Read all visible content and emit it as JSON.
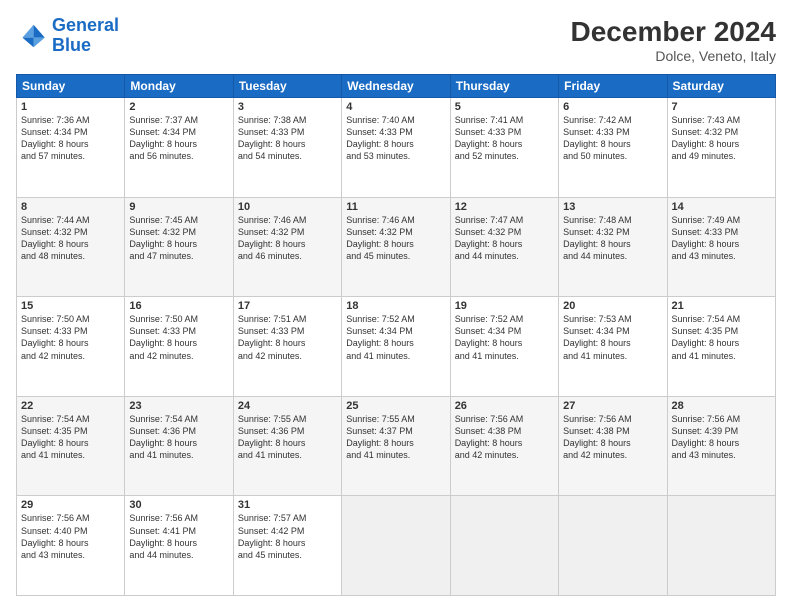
{
  "header": {
    "logo_line1": "General",
    "logo_line2": "Blue",
    "month": "December 2024",
    "location": "Dolce, Veneto, Italy"
  },
  "weekdays": [
    "Sunday",
    "Monday",
    "Tuesday",
    "Wednesday",
    "Thursday",
    "Friday",
    "Saturday"
  ],
  "weeks": [
    [
      {
        "day": "1",
        "sunrise": "7:36 AM",
        "sunset": "4:34 PM",
        "daylight": "8 hours and 57 minutes."
      },
      {
        "day": "2",
        "sunrise": "7:37 AM",
        "sunset": "4:34 PM",
        "daylight": "8 hours and 56 minutes."
      },
      {
        "day": "3",
        "sunrise": "7:38 AM",
        "sunset": "4:33 PM",
        "daylight": "8 hours and 54 minutes."
      },
      {
        "day": "4",
        "sunrise": "7:40 AM",
        "sunset": "4:33 PM",
        "daylight": "8 hours and 53 minutes."
      },
      {
        "day": "5",
        "sunrise": "7:41 AM",
        "sunset": "4:33 PM",
        "daylight": "8 hours and 52 minutes."
      },
      {
        "day": "6",
        "sunrise": "7:42 AM",
        "sunset": "4:33 PM",
        "daylight": "8 hours and 50 minutes."
      },
      {
        "day": "7",
        "sunrise": "7:43 AM",
        "sunset": "4:32 PM",
        "daylight": "8 hours and 49 minutes."
      }
    ],
    [
      {
        "day": "8",
        "sunrise": "7:44 AM",
        "sunset": "4:32 PM",
        "daylight": "8 hours and 48 minutes."
      },
      {
        "day": "9",
        "sunrise": "7:45 AM",
        "sunset": "4:32 PM",
        "daylight": "8 hours and 47 minutes."
      },
      {
        "day": "10",
        "sunrise": "7:46 AM",
        "sunset": "4:32 PM",
        "daylight": "8 hours and 46 minutes."
      },
      {
        "day": "11",
        "sunrise": "7:46 AM",
        "sunset": "4:32 PM",
        "daylight": "8 hours and 45 minutes."
      },
      {
        "day": "12",
        "sunrise": "7:47 AM",
        "sunset": "4:32 PM",
        "daylight": "8 hours and 44 minutes."
      },
      {
        "day": "13",
        "sunrise": "7:48 AM",
        "sunset": "4:32 PM",
        "daylight": "8 hours and 44 minutes."
      },
      {
        "day": "14",
        "sunrise": "7:49 AM",
        "sunset": "4:33 PM",
        "daylight": "8 hours and 43 minutes."
      }
    ],
    [
      {
        "day": "15",
        "sunrise": "7:50 AM",
        "sunset": "4:33 PM",
        "daylight": "8 hours and 42 minutes."
      },
      {
        "day": "16",
        "sunrise": "7:50 AM",
        "sunset": "4:33 PM",
        "daylight": "8 hours and 42 minutes."
      },
      {
        "day": "17",
        "sunrise": "7:51 AM",
        "sunset": "4:33 PM",
        "daylight": "8 hours and 42 minutes."
      },
      {
        "day": "18",
        "sunrise": "7:52 AM",
        "sunset": "4:34 PM",
        "daylight": "8 hours and 41 minutes."
      },
      {
        "day": "19",
        "sunrise": "7:52 AM",
        "sunset": "4:34 PM",
        "daylight": "8 hours and 41 minutes."
      },
      {
        "day": "20",
        "sunrise": "7:53 AM",
        "sunset": "4:34 PM",
        "daylight": "8 hours and 41 minutes."
      },
      {
        "day": "21",
        "sunrise": "7:54 AM",
        "sunset": "4:35 PM",
        "daylight": "8 hours and 41 minutes."
      }
    ],
    [
      {
        "day": "22",
        "sunrise": "7:54 AM",
        "sunset": "4:35 PM",
        "daylight": "8 hours and 41 minutes."
      },
      {
        "day": "23",
        "sunrise": "7:54 AM",
        "sunset": "4:36 PM",
        "daylight": "8 hours and 41 minutes."
      },
      {
        "day": "24",
        "sunrise": "7:55 AM",
        "sunset": "4:36 PM",
        "daylight": "8 hours and 41 minutes."
      },
      {
        "day": "25",
        "sunrise": "7:55 AM",
        "sunset": "4:37 PM",
        "daylight": "8 hours and 41 minutes."
      },
      {
        "day": "26",
        "sunrise": "7:56 AM",
        "sunset": "4:38 PM",
        "daylight": "8 hours and 42 minutes."
      },
      {
        "day": "27",
        "sunrise": "7:56 AM",
        "sunset": "4:38 PM",
        "daylight": "8 hours and 42 minutes."
      },
      {
        "day": "28",
        "sunrise": "7:56 AM",
        "sunset": "4:39 PM",
        "daylight": "8 hours and 43 minutes."
      }
    ],
    [
      {
        "day": "29",
        "sunrise": "7:56 AM",
        "sunset": "4:40 PM",
        "daylight": "8 hours and 43 minutes."
      },
      {
        "day": "30",
        "sunrise": "7:56 AM",
        "sunset": "4:41 PM",
        "daylight": "8 hours and 44 minutes."
      },
      {
        "day": "31",
        "sunrise": "7:57 AM",
        "sunset": "4:42 PM",
        "daylight": "8 hours and 45 minutes."
      },
      null,
      null,
      null,
      null
    ]
  ]
}
